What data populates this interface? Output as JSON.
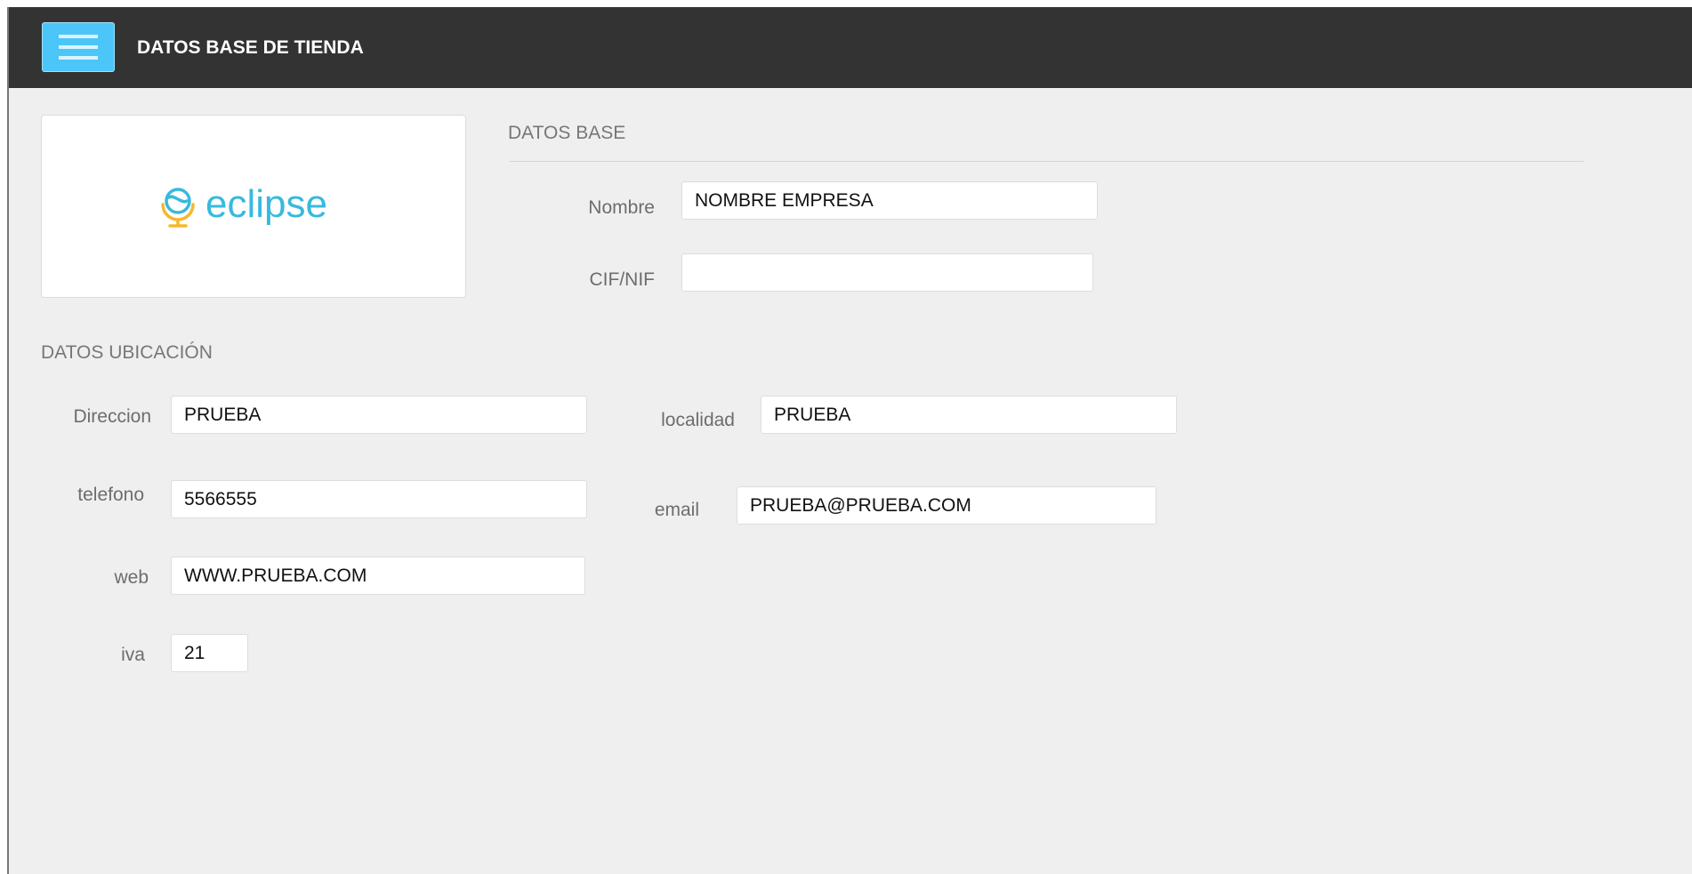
{
  "header": {
    "menu_icon": "hamburger-menu-icon",
    "title": "DATOS BASE DE TIENDA"
  },
  "logo": {
    "icon": "globe-icon",
    "text": "eclipse"
  },
  "datos_base": {
    "title": "DATOS BASE",
    "nombre_label": "Nombre",
    "nombre_value": "NOMBRE EMPRESA",
    "cif_label": "CIF/NIF",
    "cif_value": ""
  },
  "datos_ubicacion": {
    "title": "DATOS UBICACIÓN",
    "direccion_label": "Direccion",
    "direccion_value": "PRUEBA",
    "localidad_label": "localidad",
    "localidad_value": "PRUEBA",
    "telefono_label": "telefono",
    "telefono_value": "5566555",
    "email_label": "email",
    "email_value": "PRUEBA@PRUEBA.COM",
    "web_label": "web",
    "web_value": "WWW.PRUEBA.COM",
    "iva_label": "iva",
    "iva_value": "21"
  },
  "colors": {
    "header_bg": "#333333",
    "menu_button": "#4cc6f8",
    "logo_text": "#38b9de",
    "logo_globe": "#f5b82e",
    "page_bg": "#efefef"
  }
}
